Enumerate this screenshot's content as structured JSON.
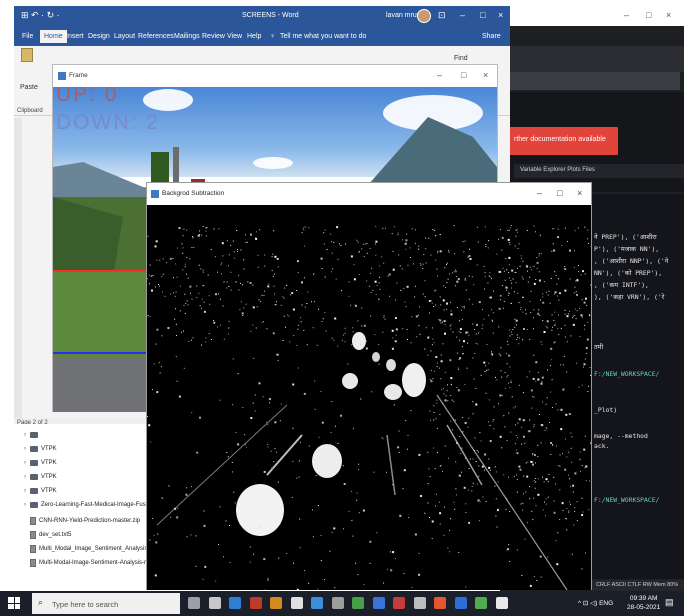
{
  "ide": {
    "titlebar_controls": [
      "–",
      "□",
      "×"
    ],
    "doc_banner": "rther documentation available",
    "tabs": "Variable Explorer  Plots  Files",
    "console_lines": [
      "ने PREP'), ('आशीरा",
      "P'), ('मजाक NN'),",
      ", ('आशीरा NNP'), ('ने",
      "NN'), ('को PREP'),",
      ", ('कम INTF'),",
      "), ('कहा VRN'), ('रे",
      "तमी",
      "F:/NEW_WORKSPACE/",
      "_Plot)",
      "mage, --method",
      "ack.",
      "F:/NEW_WORKSPACE/"
    ],
    "status": "CRLF   ASCII   CTLF   RW   Mem 80%"
  },
  "word": {
    "title": "SCREENS - Word",
    "user": "lavan mruuk",
    "qat": "⊞ ↶ · ↻ ·",
    "window_controls": [
      "⊡",
      "–",
      "□",
      "×"
    ],
    "tabs": [
      "File",
      "Home",
      "Insert",
      "Design",
      "Layout",
      "References",
      "Mailings",
      "Review",
      "View",
      "Help",
      "Tell me what you want to do",
      "Share"
    ],
    "paste_label": "Paste",
    "clipboard_label": "Clipboard",
    "find_label": "Find",
    "status": "Page 2 of 2"
  },
  "explorer": {
    "items": [
      {
        "label": "",
        "type": "folder"
      },
      {
        "label": "VTPK",
        "type": "folder"
      },
      {
        "label": "VTPK",
        "type": "folder"
      },
      {
        "label": "VTPK",
        "type": "folder"
      },
      {
        "label": "VTPK",
        "type": "folder"
      },
      {
        "label": "Zero-Learning-Fast-Medical-Image-Fusion-ma",
        "type": "folder"
      },
      {
        "label": "CNN-RNN-Yield-Prediction-master.zip",
        "type": "file"
      },
      {
        "label": "dev_set.txt5",
        "type": "file"
      },
      {
        "label": "Multi_Modal_Image_Sentiment_Analysis_Repo",
        "type": "file"
      },
      {
        "label": "Multi-Modal-Image-Sentiment-Analysis-mast",
        "type": "file"
      }
    ]
  },
  "frame": {
    "title": "Frame",
    "controls": [
      "–",
      "□",
      "×"
    ],
    "counter_up": "UP: 0",
    "counter_down": "DOWN: 2"
  },
  "bgsub": {
    "title": "Backgrod Subtraction",
    "controls": [
      "–",
      "□",
      "×"
    ]
  },
  "taskbar": {
    "search_placeholder": "Type here to search",
    "app_icon_colors": [
      "#9aa0a6",
      "#c7c7c7",
      "#2f7fd8",
      "#c03a2b",
      "#d08a1e",
      "#e0e0e0",
      "#3b8de0",
      "#9e9e9e",
      "#4aa04a",
      "#3b74d8",
      "#c43c3c",
      "#bdbdbd",
      "#e4572e",
      "#2c6ed5",
      "#4cae4c",
      "#e8e8e8"
    ],
    "tray": "^  ⊡  ◁)  ENG",
    "time": "09:39 AM",
    "date": "28-05-2021"
  },
  "colors": {
    "word_blue": "#2b579a",
    "doc_banner_red": "#e0443a",
    "counter_line_red": "#ff2b2b",
    "counter_line_blue": "#2a2aff"
  }
}
